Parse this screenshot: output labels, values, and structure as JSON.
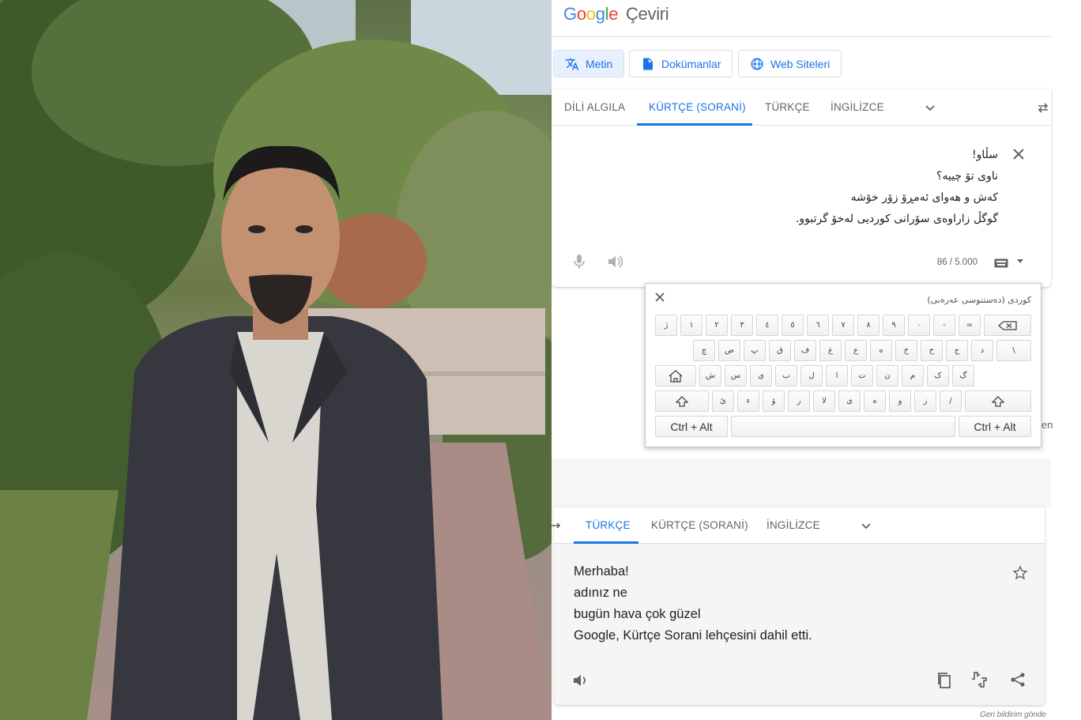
{
  "header": {
    "logo_letters": [
      "G",
      "o",
      "o",
      "g",
      "l",
      "e"
    ],
    "logo_colors": [
      "#4285F4",
      "#EA4335",
      "#FBBC05",
      "#4285F4",
      "#34A853",
      "#EA4335"
    ],
    "product": "Çeviri"
  },
  "modes": [
    {
      "label": "Metin",
      "icon": "translate-icon",
      "active": true
    },
    {
      "label": "Dokümanlar",
      "icon": "document-icon",
      "active": false
    },
    {
      "label": "Web Siteleri",
      "icon": "globe-icon",
      "active": false
    }
  ],
  "source": {
    "tabs": [
      {
        "label": "DİLİ ALGILA",
        "active": false
      },
      {
        "label": "KÜRTÇE (SORANİ)",
        "active": true
      },
      {
        "label": "TÜRKÇE",
        "active": false
      },
      {
        "label": "İNGİLİZCE",
        "active": false
      }
    ],
    "lines": [
      "سڵاو!",
      "ناوی تۆ چییە؟",
      "کەش و هەوای ئەمڕۆ زۆر خۆشە",
      "گوگڵ زاراوەی سۆرانی کوردیی لەخۆ گرتبوو."
    ],
    "counter": "86 / 5.000",
    "icons": [
      "mic-icon",
      "speaker-icon",
      "keyboard-icon",
      "caret-down-icon",
      "clear-icon",
      "swap-icon"
    ]
  },
  "keyboard": {
    "title": "كوردی (دەستنوسی عەرەبی)",
    "rows": [
      [
        "ژ",
        "١",
        "٢",
        "٣",
        "٤",
        "٥",
        "٦",
        "٧",
        "٨",
        "٩",
        "٠",
        "-",
        "="
      ],
      [
        "چ",
        "ص",
        "پ",
        "ق",
        "ف",
        "غ",
        "ع",
        "ه",
        "خ",
        "ح",
        "ج",
        "د",
        "\\"
      ],
      [
        "ش",
        "س",
        "ی",
        "ب",
        "ل",
        "ا",
        "ت",
        "ن",
        "م",
        "ک",
        "گ"
      ],
      [
        "ئ",
        "ء",
        "ۆ",
        "ر",
        "لا",
        "ى",
        "ە",
        "و",
        "ز",
        "/"
      ]
    ],
    "ctrl_left": "Ctrl + Alt",
    "ctrl_right": "Ctrl + Alt",
    "icons": [
      "backspace-icon",
      "shift-icon",
      "home-key-icon",
      "close-icon"
    ]
  },
  "side_fragment": "en",
  "target": {
    "tabs": [
      {
        "label": "TÜRKÇE",
        "active": true
      },
      {
        "label": "KÜRTÇE (SORANİ)",
        "active": false
      },
      {
        "label": "İNGİLİZCE",
        "active": false
      }
    ],
    "lines": [
      "Merhaba!",
      "adınız ne",
      "bugün hava çok güzel",
      "Google, Kürtçe Sorani lehçesini dahil etti."
    ],
    "icons": [
      "star-icon",
      "speaker-icon",
      "copy-icon",
      "rate-icon",
      "share-icon"
    ]
  },
  "feedback": "Geri bildirim gönde"
}
